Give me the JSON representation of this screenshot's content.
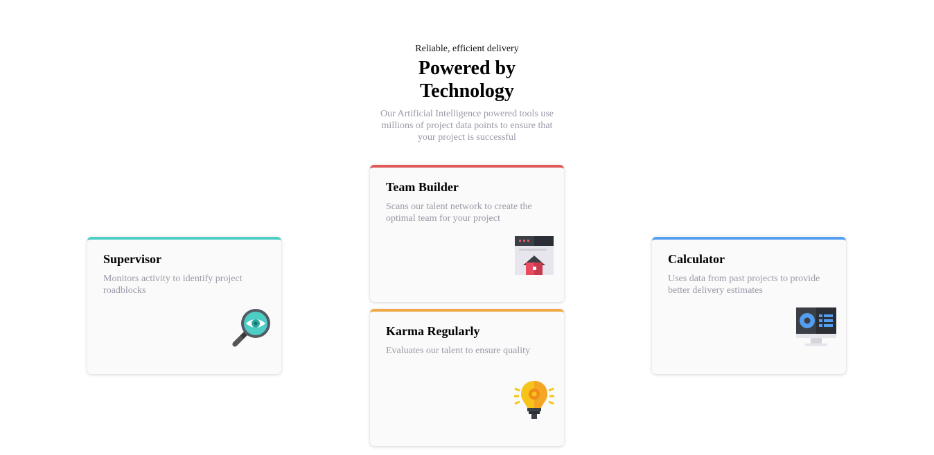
{
  "header": {
    "eyebrow": "Reliable, efficient delivery",
    "title": "Powered by Technology",
    "subtitle": "Our Artificial Intelligence powered tools use millions of project data points to ensure that your project is successful"
  },
  "cards": [
    {
      "id": "supervisor",
      "title": "Supervisor",
      "description": "Monitors activity to identify project roadblocks",
      "accent": "#4ecdc4",
      "icon": "magnifier-eye-icon"
    },
    {
      "id": "team-builder",
      "title": "Team Builder",
      "description": "Scans our talent network to create the optimal team for your project",
      "accent": "#e05a5a",
      "icon": "browser-house-icon"
    },
    {
      "id": "karma",
      "title": "Karma Regularly",
      "description": "Evaluates our talent to ensure quality",
      "accent": "#f2a94a",
      "icon": "lightbulb-gear-icon"
    },
    {
      "id": "calculator",
      "title": "Calculator",
      "description": "Uses data from past projects to provide better delivery estimates",
      "accent": "#549ef2",
      "icon": "monitor-chart-icon"
    }
  ]
}
